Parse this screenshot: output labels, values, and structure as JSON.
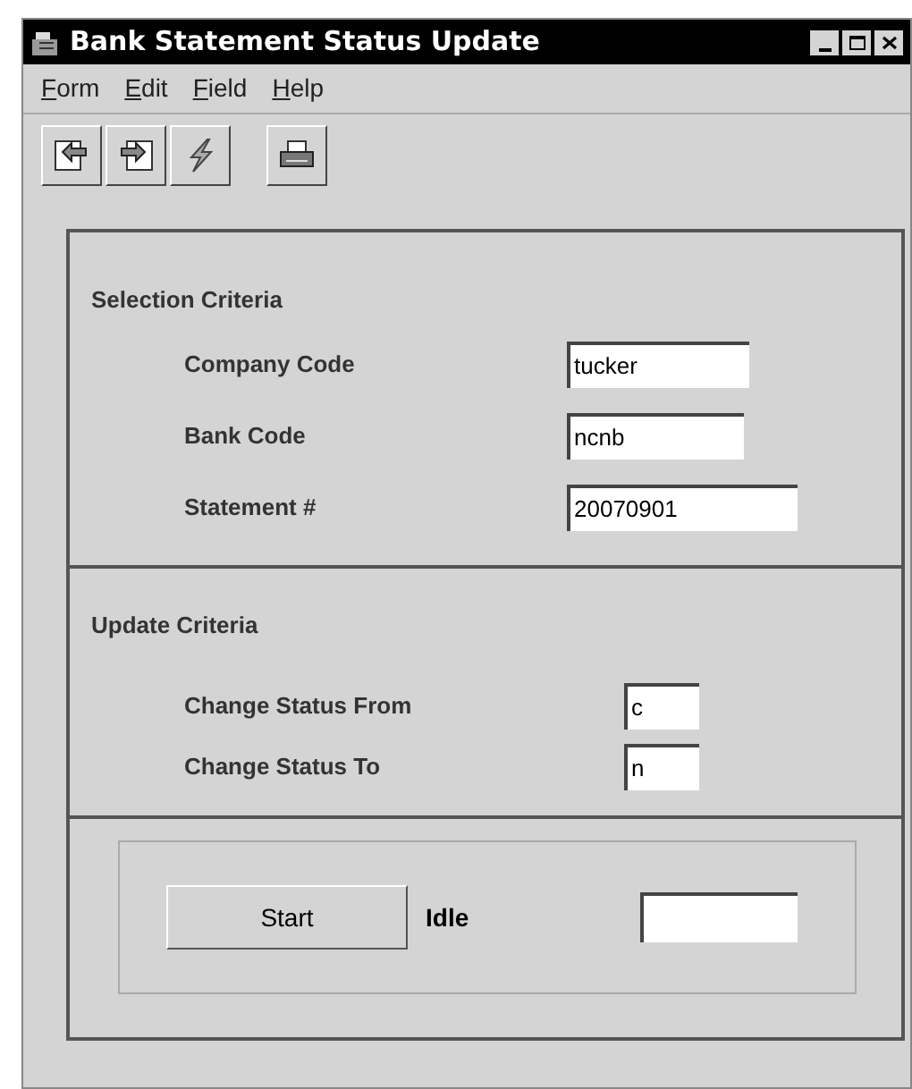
{
  "window": {
    "title": "Bank Statement Status Update"
  },
  "menu": [
    "Form",
    "Edit",
    "Field",
    "Help"
  ],
  "toolbar": [
    {
      "kind": "back"
    },
    {
      "kind": "forward"
    },
    {
      "kind": "lightning"
    },
    {
      "kind": "print"
    }
  ],
  "selection_criteria": {
    "title": "Selection Criteria",
    "fields": [
      {
        "label": "Company Code",
        "value": "tucker"
      },
      {
        "label": "Bank Code",
        "value": "ncnb"
      },
      {
        "label": "Statement #",
        "value": "20070901"
      }
    ]
  },
  "update_criteria": {
    "title": "Update Criteria",
    "fields": [
      {
        "label": "Change Status From",
        "value": "c"
      },
      {
        "label": "Change Status To",
        "value": "n"
      }
    ]
  },
  "run": {
    "button": "Start",
    "status": "Idle"
  }
}
